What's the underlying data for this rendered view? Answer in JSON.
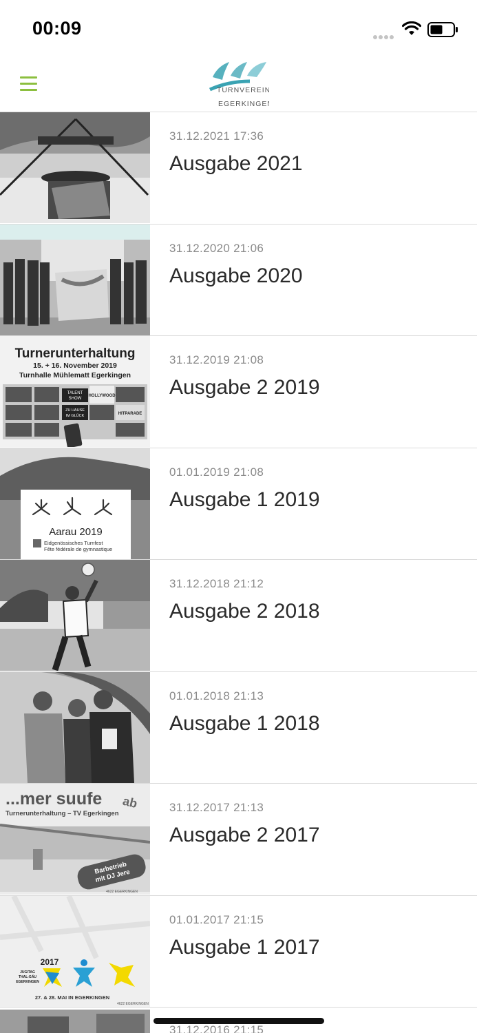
{
  "status_bar": {
    "time": "00:09"
  },
  "header": {
    "logo_line1": "TURNVEREIN",
    "logo_line2": "EGERKINGEN",
    "colors": {
      "menu": "#8cbf3f",
      "logo_teal": "#3aa3b3"
    }
  },
  "issues": [
    {
      "date": "31.12.2021 17:36",
      "title": "Ausgabe 2021"
    },
    {
      "date": "31.12.2020 21:06",
      "title": "Ausgabe 2020"
    },
    {
      "date": "31.12.2019 21:08",
      "title": "Ausgabe 2 2019",
      "thumb_text": {
        "heading": "Turnerunterhaltung",
        "sub1": "15. + 16. November 2019",
        "sub2": "Turnhalle Mühlematt Egerkingen",
        "tile1": "TALENT SHOW",
        "tile2": "HOLLYWOOD",
        "tile3": "ZU HAUSE IM GLÜCK",
        "tile4": "HITPARADE"
      }
    },
    {
      "date": "01.01.2019 21:08",
      "title": "Ausgabe 1 2019",
      "thumb_text": {
        "heading": "Aarau 2019",
        "sub1": "Eidgenössisches Turnfest",
        "sub2": "Fête fédérale de gymnastique"
      }
    },
    {
      "date": "31.12.2018 21:12",
      "title": "Ausgabe 2 2018"
    },
    {
      "date": "01.01.2018 21:13",
      "title": "Ausgabe 1 2018"
    },
    {
      "date": "31.12.2017 21:13",
      "title": "Ausgabe 2 2017",
      "thumb_text": {
        "heading": "...mer suufe",
        "heading2": "ab",
        "sub1": "Turnerunterhaltung – TV Egerkingen",
        "badge1": "Barbetrieb",
        "badge2": "mit DJ Jere",
        "footer": "4622 EGERKINGEN"
      }
    },
    {
      "date": "01.01.2017 21:15",
      "title": "Ausgabe 1 2017",
      "thumb_text": {
        "year": "2017",
        "logo_text": "JUGITAG THAL-GÄU EGERKINGEN",
        "caption": "27. & 28. MAI IN EGERKINGEN",
        "footer": "4622 EGERKINGEN"
      }
    }
  ],
  "partial_item": {
    "date": "31.12.2016 21:15"
  }
}
